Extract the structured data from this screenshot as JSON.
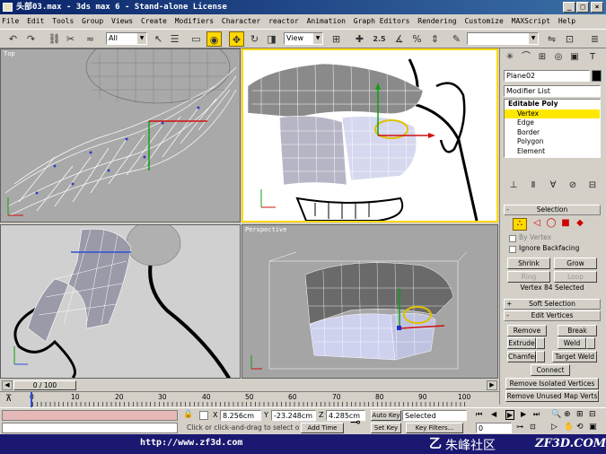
{
  "window": {
    "title": "头部03.max - 3ds max 6 - Stand-alone License",
    "minimize": "_",
    "maximize": "□",
    "close": "×"
  },
  "menu": [
    "File",
    "Edit",
    "Tools",
    "Group",
    "Views",
    "Create",
    "Modifiers",
    "Character",
    "reactor",
    "Animation",
    "Graph Editors",
    "Rendering",
    "Customize",
    "MAXScript",
    "Help"
  ],
  "toolbar": {
    "selection_filter": "All",
    "reference_coord": "View",
    "snap_label": "2.5"
  },
  "viewports": {
    "top_left": "Top",
    "top_right": "",
    "bottom_left": "",
    "bottom_right": "Perspective"
  },
  "command_panel": {
    "object_name": "Plane02",
    "modifier_list": "Modifier List",
    "stack": {
      "header": "Editable Poly",
      "items": [
        "Vertex",
        "Edge",
        "Border",
        "Polygon",
        "Element"
      ],
      "selected": "Vertex"
    },
    "selection": {
      "title": "Selection",
      "by_vertex": "By Vertex",
      "ignore_backfacing": "Ignore Backfacing",
      "shrink": "Shrink",
      "grow": "Grow",
      "ring": "Ring",
      "loop": "Loop",
      "status": "Vertex 84 Selected"
    },
    "soft_selection": {
      "title": "Soft Selection",
      "sign": "+"
    },
    "edit_vertices": {
      "title": "Edit Vertices",
      "sign": "-",
      "remove": "Remove",
      "break": "Break",
      "extrude": "Extrude",
      "weld": "Weld",
      "chamfer": "Chamfer",
      "target_weld": "Target Weld",
      "connect": "Connect",
      "remove_isolated": "Remove Isolated Vertices",
      "remove_unused": "Remove Unused Map Verts"
    }
  },
  "timeline": {
    "frame": "0 / 100",
    "ticks": [
      "0",
      "10",
      "20",
      "30",
      "40",
      "50",
      "60",
      "70",
      "80",
      "90",
      "100"
    ]
  },
  "status": {
    "x_label": "X",
    "x": "8.256cm",
    "y_label": "Y",
    "y": "-23.248cm",
    "z_label": "Z",
    "z": "4.285cm",
    "prompt": "Click or click-and-drag to select o",
    "add_time_tag": "Add Time Tag",
    "auto_key": "Auto Key",
    "set_key": "Set Key",
    "key_set": "Selected",
    "key_filters": "Key Filters...",
    "frame_field": "0"
  },
  "footer": {
    "url": "http://www.zf3d.com",
    "brand_cn": "朱峰社区",
    "brand_en": "ZF3D.COM"
  },
  "colors": {
    "selection_yellow": "#ffd800",
    "titlebar": "#0a246a",
    "footer_bg": "#1a1870",
    "viewport_bg": "#a9a9a9"
  }
}
